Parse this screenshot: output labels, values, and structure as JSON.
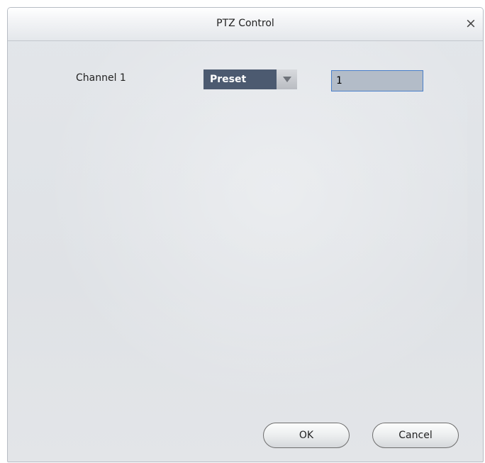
{
  "dialog": {
    "title": "PTZ Control",
    "close_glyph": "×",
    "close_icon": "close-icon"
  },
  "form": {
    "channel_label": "Channel 1",
    "action_select": {
      "selected": "Preset",
      "arrow_icon": "chevron-down-icon"
    },
    "preset_value": "1"
  },
  "buttons": {
    "ok_label": "OK",
    "cancel_label": "Cancel"
  },
  "colors": {
    "select_background": "#4c5a70",
    "input_border": "#4a7fc9",
    "input_background": "#b3bcc8"
  }
}
